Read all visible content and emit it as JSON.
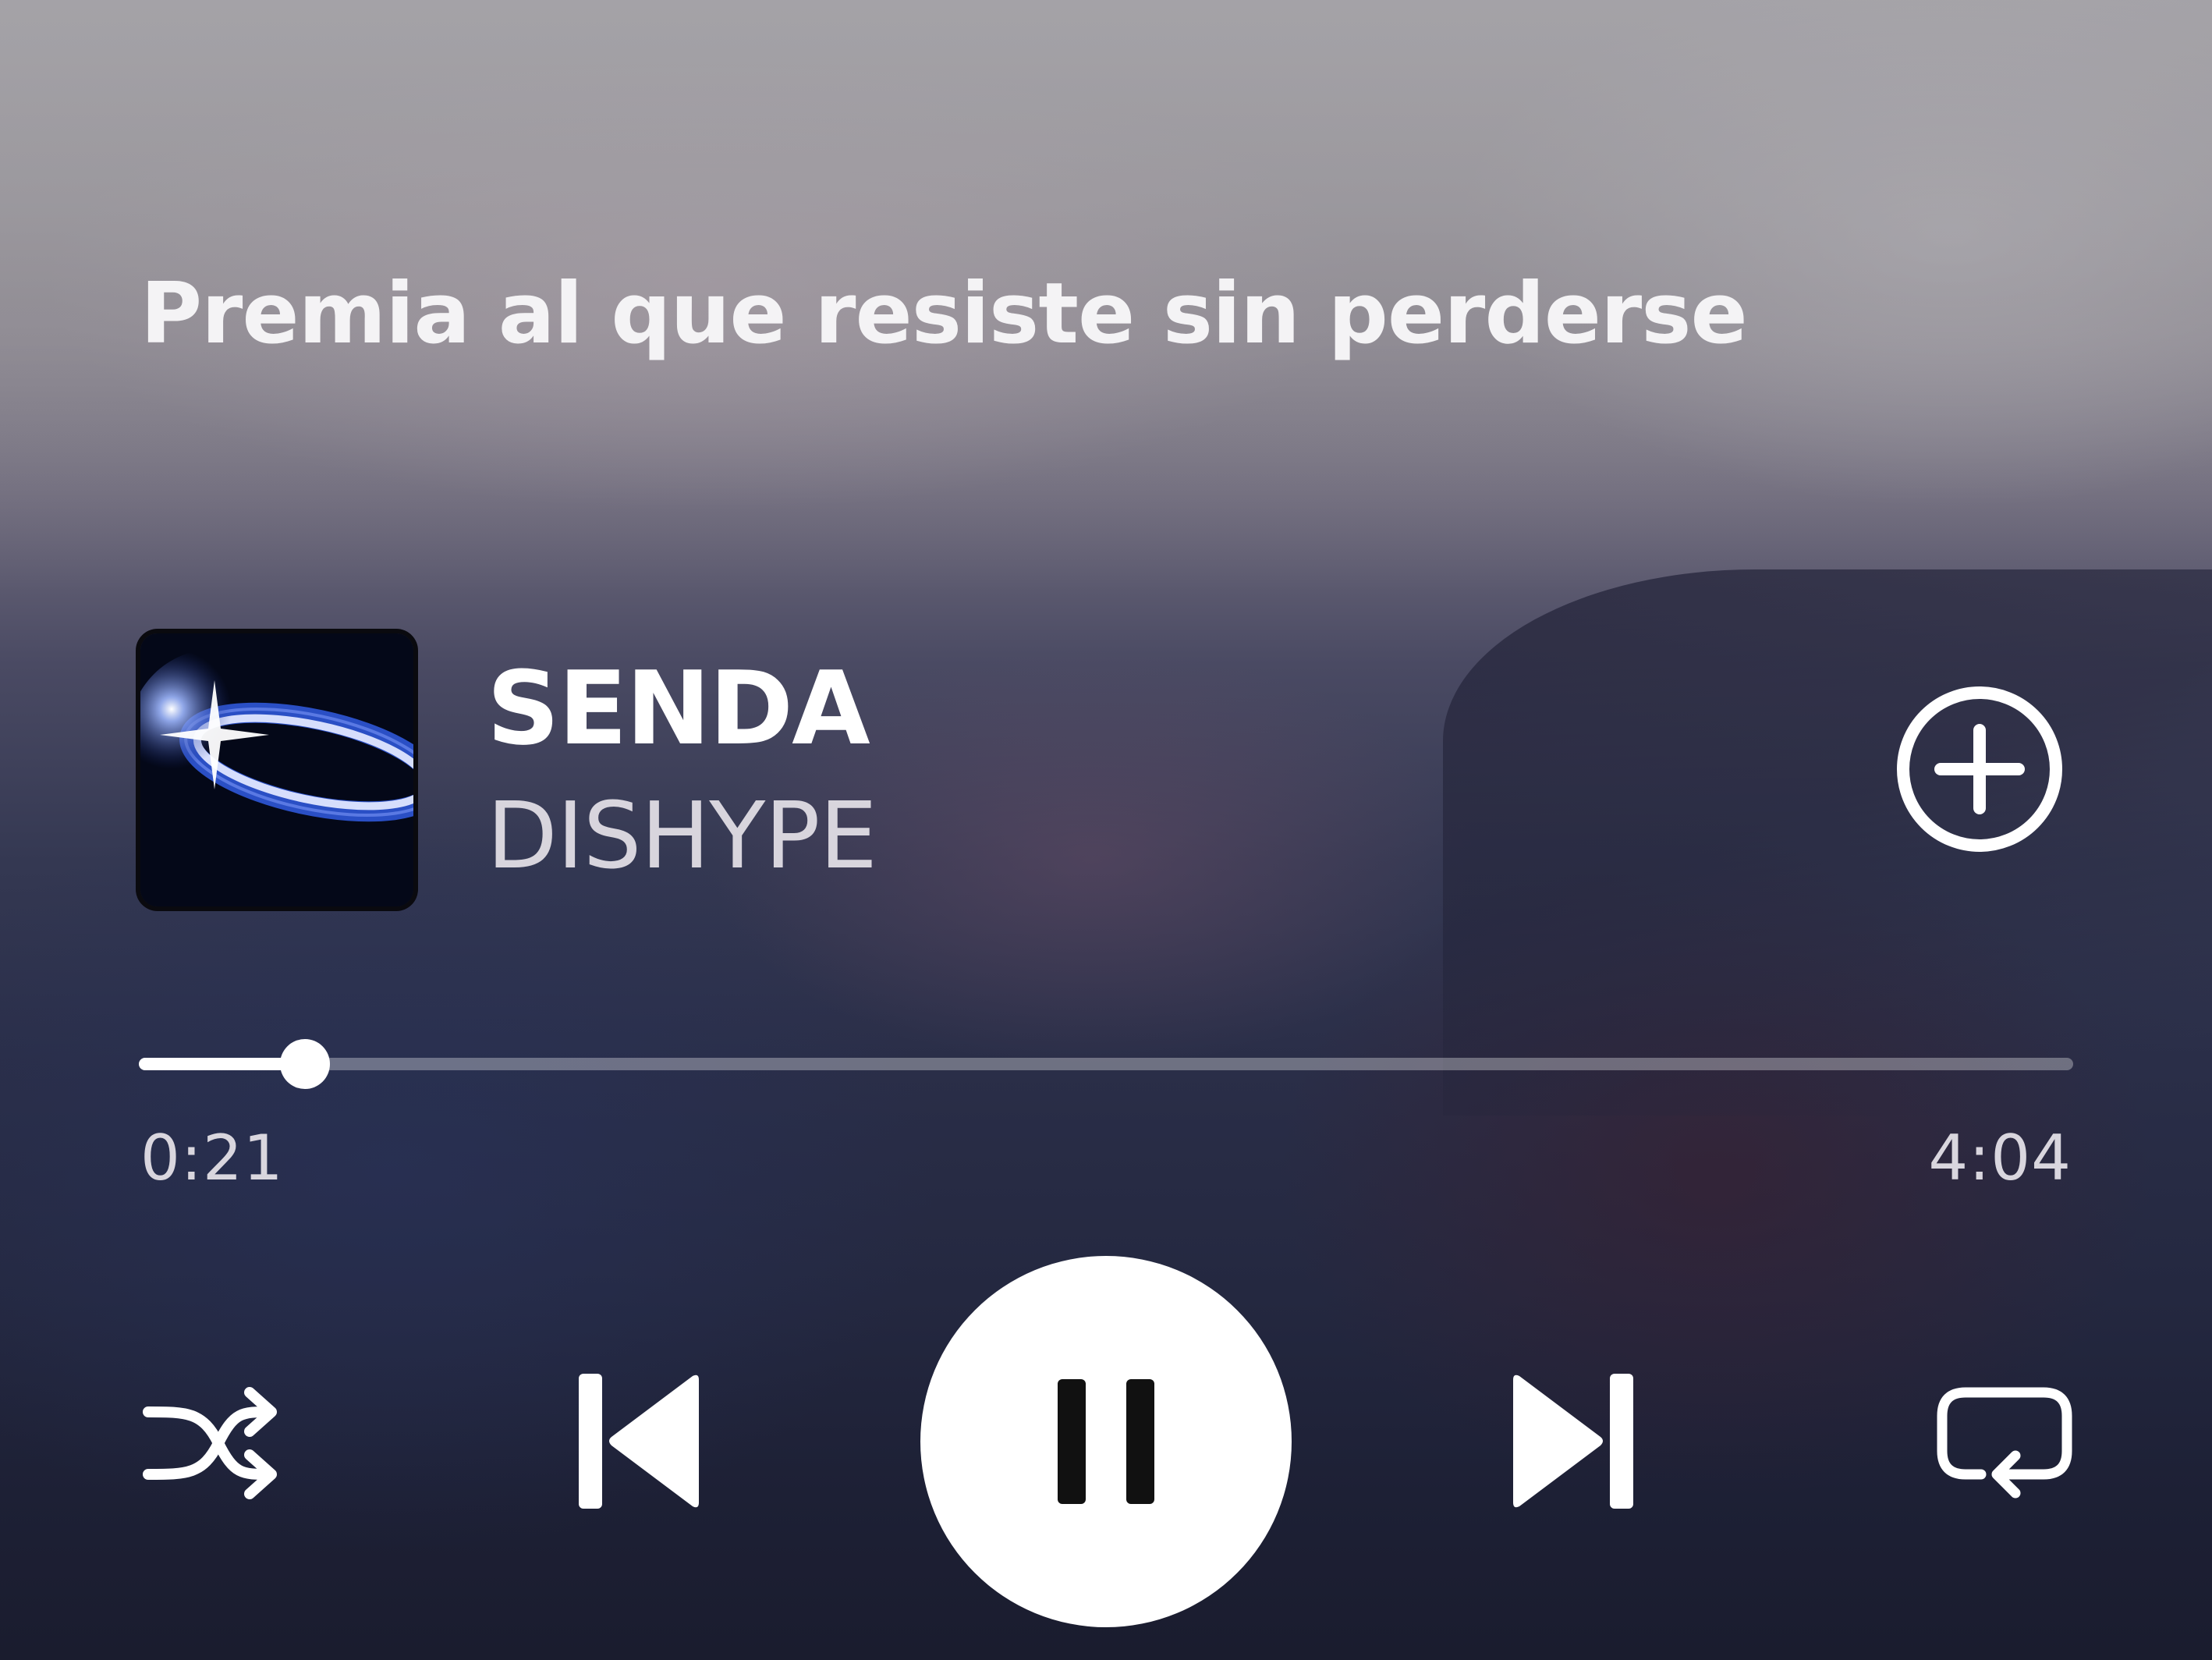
{
  "lyrics": {
    "current_line": "Premia al que resiste sin perderse"
  },
  "track": {
    "title": "SENDA",
    "artist": "DISHYPE",
    "cover_icon": "album-cover"
  },
  "playback": {
    "elapsed": "0:21",
    "duration": "4:04",
    "progress_fraction": 0.086,
    "is_playing": true
  },
  "controls": {
    "add_icon": "plus-circle-icon",
    "shuffle_icon": "shuffle-icon",
    "previous_icon": "skip-previous-icon",
    "pause_icon": "pause-icon",
    "next_icon": "skip-next-icon",
    "repeat_icon": "repeat-icon"
  },
  "colors": {
    "foreground": "#ffffff",
    "secondary_text": "#d8d5dd",
    "track_bg": "rgba(255,255,255,0.32)"
  }
}
